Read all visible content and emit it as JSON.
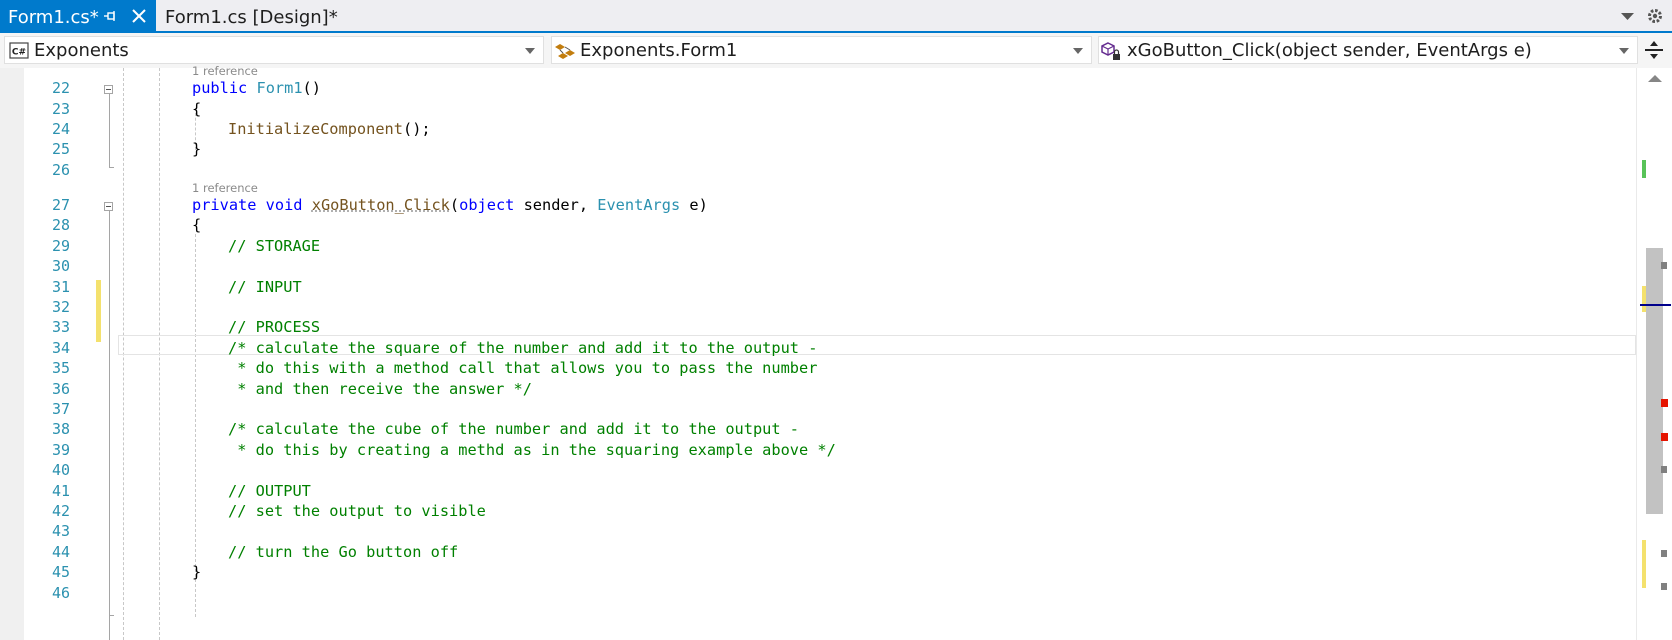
{
  "tabs": [
    {
      "label": "Form1.cs*",
      "active": true
    },
    {
      "label": "Form1.cs [Design]*",
      "active": false
    }
  ],
  "navbar": {
    "project": "Exponents",
    "type": "Exponents.Form1",
    "member": "xGoButton_Click(object sender, EventArgs e)",
    "project_icon_label": "C#"
  },
  "codelens": {
    "form1": "1 reference",
    "click": "1 reference"
  },
  "lines": {
    "22": "22",
    "23": "23",
    "24": "24",
    "25": "25",
    "26": "26",
    "27": "27",
    "28": "28",
    "29": "29",
    "30": "30",
    "31": "31",
    "32": "32",
    "33": "33",
    "34": "34",
    "35": "35",
    "36": "36",
    "37": "37",
    "38": "38",
    "39": "39",
    "40": "40",
    "41": "41",
    "42": "42",
    "43": "43",
    "44": "44",
    "45": "45",
    "46": "46"
  },
  "code": {
    "l22_kw": "public",
    "l22_name": "Form1",
    "l22_rest": "()",
    "l23": "{",
    "l24_method": "InitializeComponent",
    "l24_rest": "();",
    "l25": "}",
    "l27_kw": "private void",
    "l27_name": "xGoButton_Click",
    "l27_p1": "(",
    "l27_obj": "object",
    "l27_p2": " sender, ",
    "l27_type": "EventArgs",
    "l27_p3": " e)",
    "l28": "{",
    "l29": "// STORAGE",
    "l31": "// INPUT",
    "l33": "// PROCESS",
    "l34": "/* calculate the square of the number and add it to the output -",
    "l35": " * do this with a method call that allows you to pass the number",
    "l36": " * and then receive the answer */",
    "l38": "/* calculate the cube of the number and add it to the output -",
    "l39": " * do this by creating a methd as in the squaring example above */",
    "l41": "// OUTPUT",
    "l42": "// set the output to visible",
    "l44": "// turn the Go button off",
    "l45": "}"
  },
  "colors": {
    "accent": "#007acc",
    "keyword": "#0000ff",
    "type": "#2b91af",
    "method": "#74531f",
    "comment": "#008000",
    "line_number": "#2b91af",
    "change_marker": "#f4e16d",
    "error_marker": "#e51400"
  }
}
